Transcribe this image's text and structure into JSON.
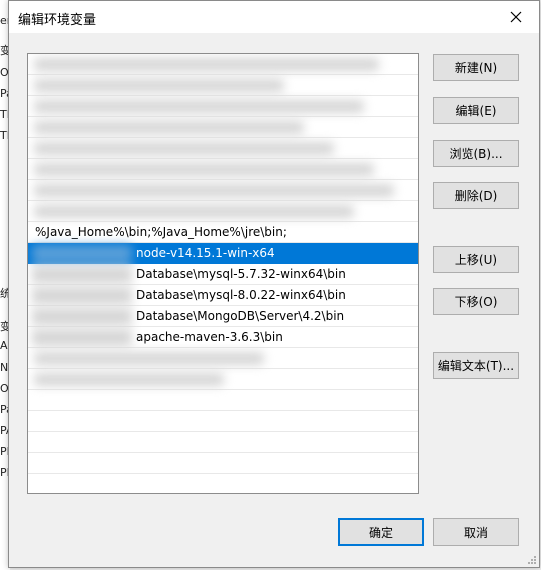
{
  "background_window": {
    "letters": [
      "er",
      "变",
      "O",
      "Pa",
      "TE",
      "TN",
      "统",
      "变",
      "A",
      "N",
      "O",
      "Pa",
      "PA",
      "PF",
      "PF"
    ]
  },
  "dialog": {
    "title": "编辑环境变量",
    "close_icon": "close-icon"
  },
  "list": {
    "items": [
      {
        "text": "",
        "blurred": true
      },
      {
        "text": "",
        "blurred": true
      },
      {
        "text": "",
        "blurred": true
      },
      {
        "text": "",
        "blurred": true
      },
      {
        "text": "",
        "blurred": true
      },
      {
        "text": "",
        "blurred": true
      },
      {
        "text": "",
        "blurred": true
      },
      {
        "text": "",
        "blurred": true
      },
      {
        "text": "%Java_Home%\\bin;%Java_Home%\\jre\\bin;"
      },
      {
        "text": "node-v14.15.1-win-x64",
        "selected": true
      },
      {
        "text": "Database\\mysql-5.7.32-winx64\\bin"
      },
      {
        "text": "Database\\mysql-8.0.22-winx64\\bin"
      },
      {
        "text": "Database\\MongoDB\\Server\\4.2\\bin"
      },
      {
        "text": "apache-maven-3.6.3\\bin"
      },
      {
        "text": "",
        "blurred": true
      },
      {
        "text": "",
        "blurred": true
      },
      {
        "text": ""
      },
      {
        "text": ""
      },
      {
        "text": ""
      },
      {
        "text": ""
      }
    ]
  },
  "buttons": {
    "new": "新建(N)",
    "edit": "编辑(E)",
    "browse": "浏览(B)...",
    "delete": "删除(D)",
    "move_up": "上移(U)",
    "move_down": "下移(O)",
    "edit_text": "编辑文本(T)...",
    "ok": "确定",
    "cancel": "取消"
  },
  "colors": {
    "selection": "#0078d7",
    "button_face": "#e1e1e1",
    "default_border": "#0078d7"
  }
}
